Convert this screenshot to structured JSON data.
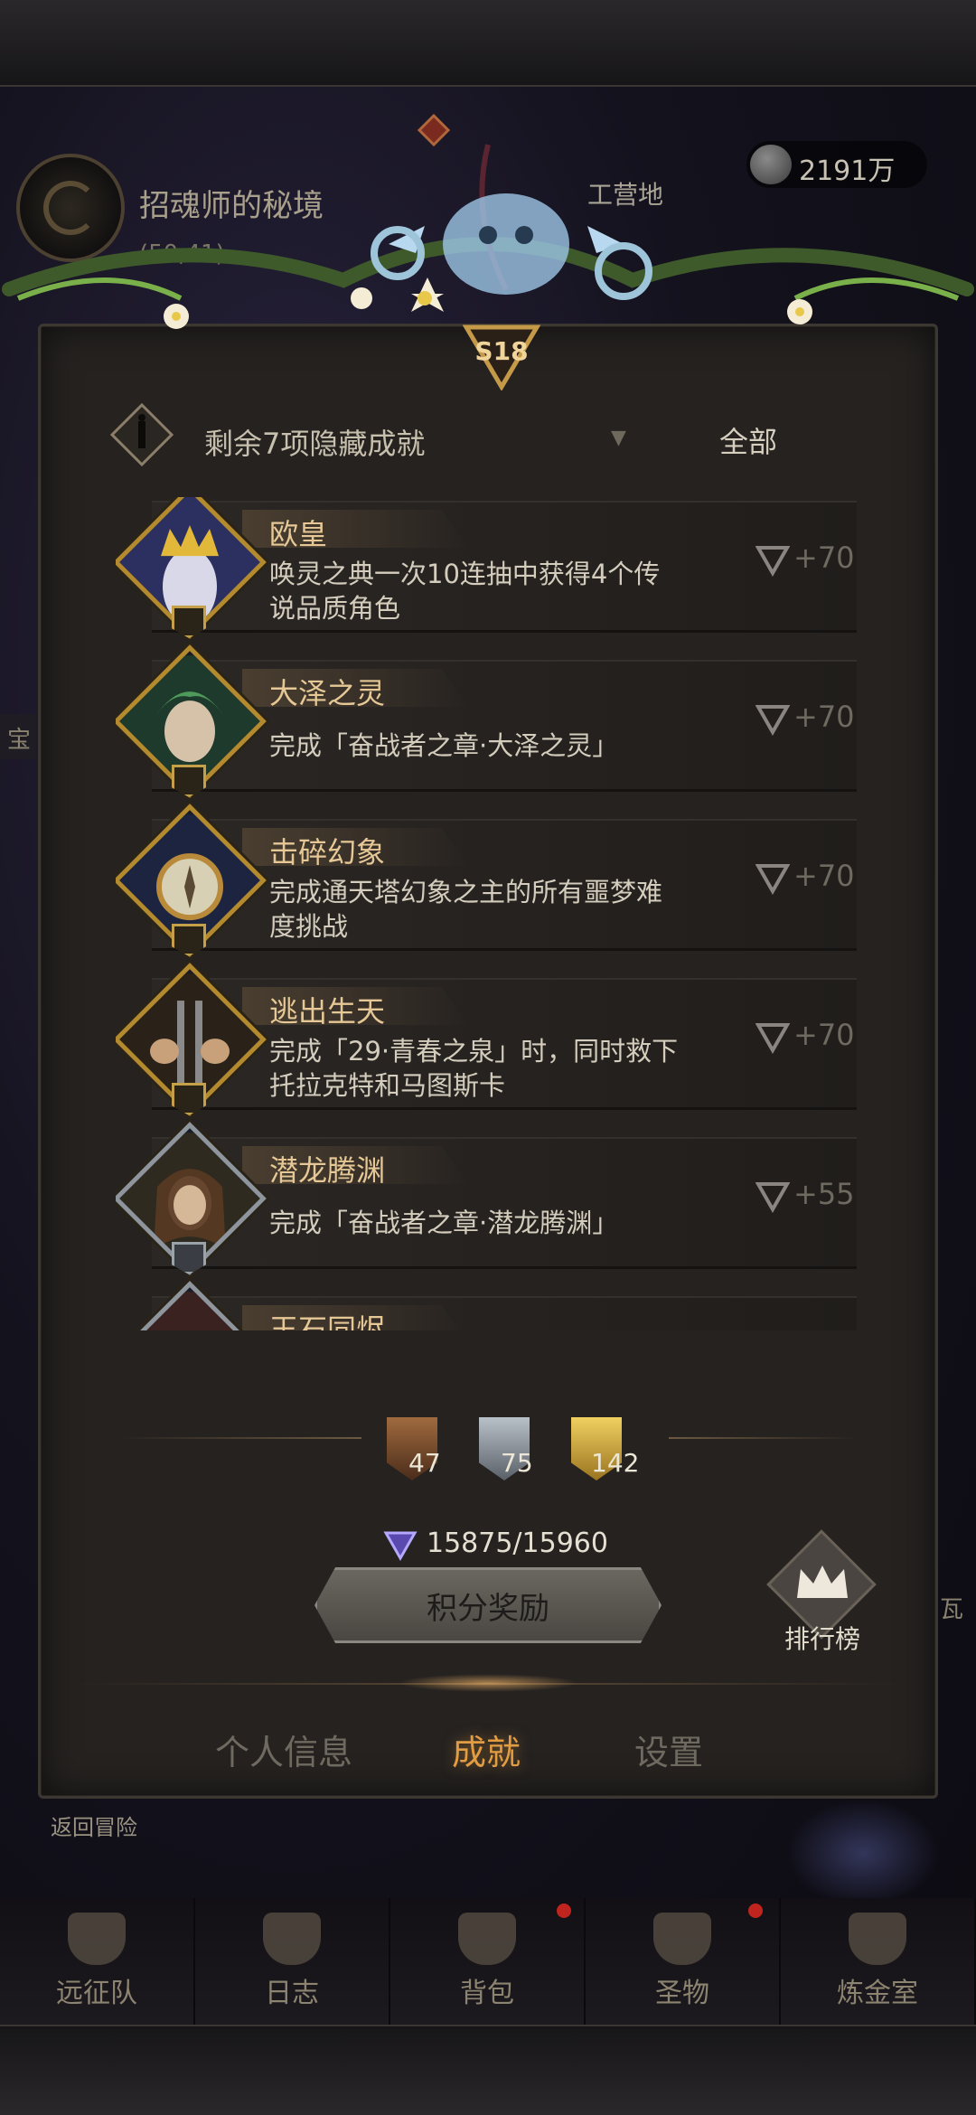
{
  "background": {
    "location_title": "招魂师的秘境",
    "coords": "(50,41)",
    "gold": "2191万",
    "camp_label": "工营地",
    "side_left_text": "宝",
    "side_right_text": "瓦",
    "return_label": "返回冒险"
  },
  "panel": {
    "season_badge": "S18",
    "hidden_text": "剩余7项隐藏成就",
    "filter_label": "全部",
    "achievements": [
      {
        "title": "欧皇",
        "desc": "唤灵之典一次10连抽中获得4个传说品质角色",
        "points": "+70",
        "tier": "gold"
      },
      {
        "title": "大泽之灵",
        "desc": "完成「奋战者之章·大泽之灵」",
        "points": "+70",
        "tier": "gold"
      },
      {
        "title": "击碎幻象",
        "desc": "完成通天塔幻象之主的所有噩梦难度挑战",
        "points": "+70",
        "tier": "gold"
      },
      {
        "title": "逃出生天",
        "desc": "完成「29·青春之泉」时，同时救下托拉克特和马图斯卡",
        "points": "+70",
        "tier": "gold"
      },
      {
        "title": "潜龙腾渊",
        "desc": "完成「奋战者之章·潜龙腾渊」",
        "points": "+55",
        "tier": "silver"
      },
      {
        "title": "玉石同烬",
        "desc": "",
        "points": "",
        "tier": "silver"
      }
    ],
    "tier_counts": {
      "bronze": "47",
      "silver": "75",
      "gold": "142"
    },
    "score": "15875/15960",
    "reward_button": "积分奖励",
    "ranking_label": "排行榜",
    "tabs": [
      "个人信息",
      "成就",
      "设置"
    ],
    "active_tab": 1
  },
  "bottom_nav": [
    "远征队",
    "日志",
    "背包",
    "圣物",
    "炼金室"
  ],
  "colors": {
    "accent": "#e29c42",
    "title_gold": "#e6c896",
    "panel": "#252220"
  }
}
